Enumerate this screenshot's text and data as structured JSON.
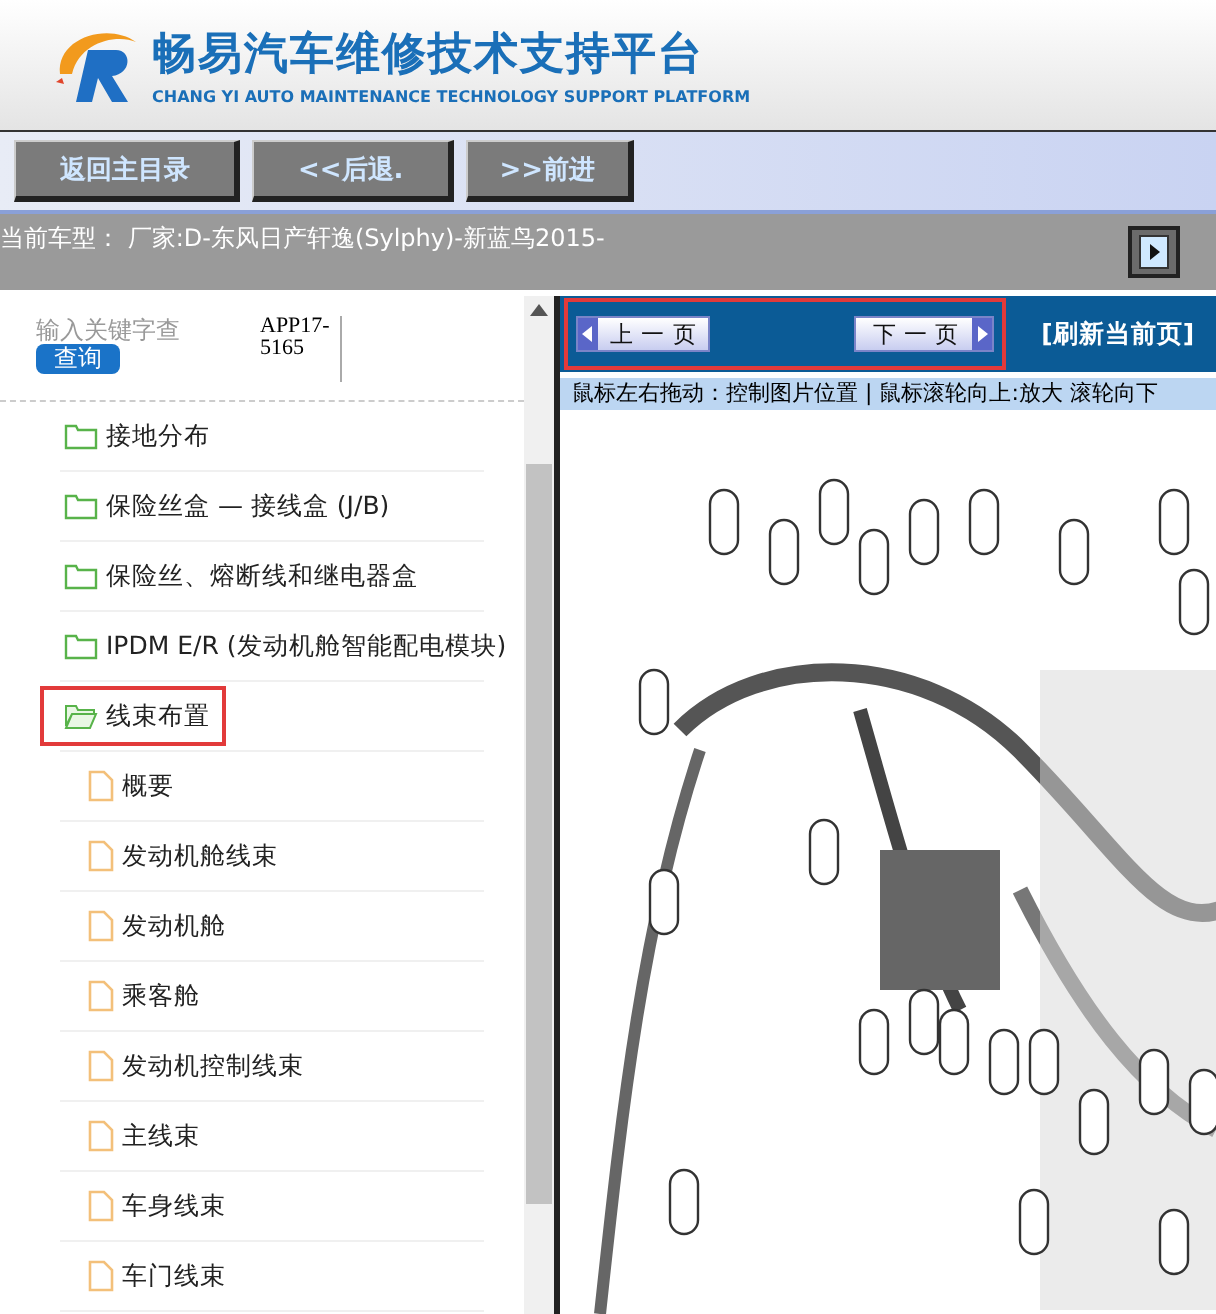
{
  "header": {
    "title": "畅易汽车维修技术支持平台",
    "subtitle": "CHANG YI AUTO MAINTENANCE TECHNOLOGY SUPPORT PLATFORM"
  },
  "nav_buttons": [
    "返回主目录",
    "<<后退.",
    ">>前进"
  ],
  "vehicle_bar": {
    "label": "当前车型：",
    "value": "厂家:D-东风日产轩逸(Sylphy)-新蓝鸟2015-"
  },
  "search": {
    "placeholder": "输入关键字查",
    "button": "查询",
    "code": "APP17-5165"
  },
  "tree": [
    {
      "label": "接地分布",
      "kind": "folder",
      "expanded": false,
      "selected": false
    },
    {
      "label": "保险丝盒 — 接线盒 (J/B)",
      "kind": "folder",
      "expanded": false,
      "selected": false
    },
    {
      "label": "保险丝、熔断线和继电器盒",
      "kind": "folder",
      "expanded": false,
      "selected": false
    },
    {
      "label": "IPDM E/R (发动机舱智能配电模块)",
      "kind": "folder",
      "expanded": false,
      "selected": false
    },
    {
      "label": "线束布置",
      "kind": "folder",
      "expanded": true,
      "selected": true,
      "children": [
        {
          "label": "概要",
          "kind": "file",
          "selected": false
        },
        {
          "label": "发动机舱线束",
          "kind": "file",
          "selected": false
        },
        {
          "label": "发动机舱",
          "kind": "file",
          "selected": false
        },
        {
          "label": "乘客舱",
          "kind": "file",
          "selected": false
        },
        {
          "label": "发动机控制线束",
          "kind": "file",
          "selected": false
        },
        {
          "label": "主线束",
          "kind": "file",
          "selected": false
        },
        {
          "label": "车身线束",
          "kind": "file",
          "selected": false
        },
        {
          "label": "车门线束",
          "kind": "file",
          "selected": false
        }
      ]
    }
  ],
  "pager": {
    "prev": "上 一 页",
    "next": "下 一 页",
    "refresh": "[刷新当前页]",
    "highlighted": true
  },
  "hint": "鼠标左右拖动：控制图片位置 | 鼠标滚轮向上:放大  滚轮向下"
}
